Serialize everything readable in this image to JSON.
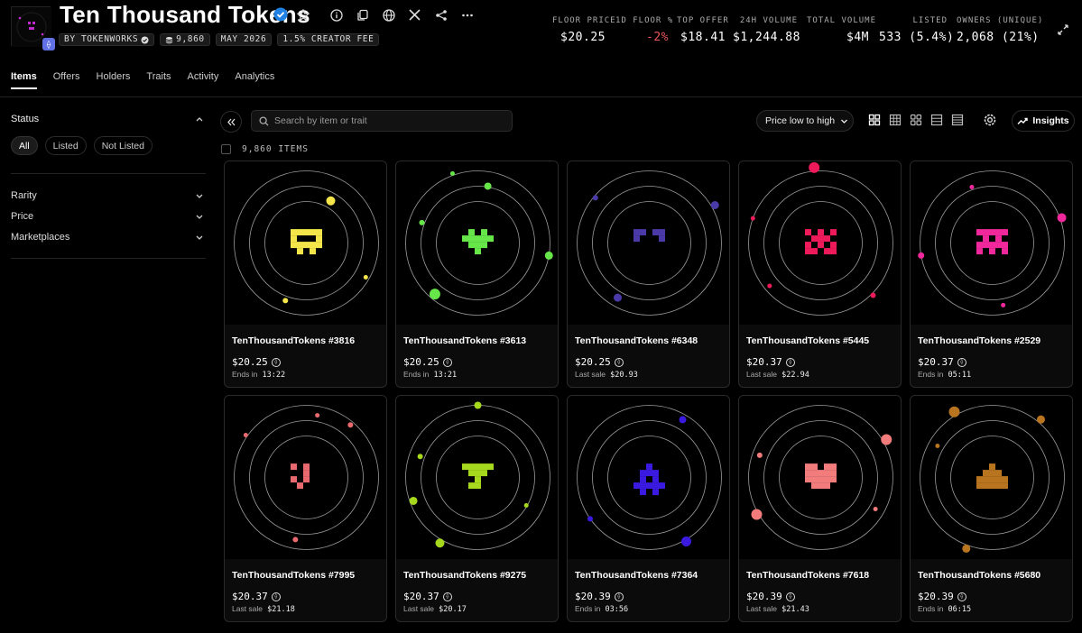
{
  "collection": {
    "title": "Ten Thousand Tokens",
    "by_label": "BY TOKENWORKS",
    "supply": "9,860",
    "date": "MAY 2026",
    "fee": "1.5% CREATOR FEE"
  },
  "stats": [
    {
      "label": "FLOOR PRICE",
      "value": "$20.25"
    },
    {
      "label": "1D FLOOR %",
      "value": "-2%"
    },
    {
      "label": "TOP OFFER",
      "value": "$18.41"
    },
    {
      "label": "24H VOLUME",
      "value": "$1,244.88"
    },
    {
      "label": "TOTAL VOLUME",
      "value": "$4M"
    },
    {
      "label": "LISTED",
      "value": "533 (5.4%)"
    },
    {
      "label": "OWNERS (UNIQUE)",
      "value": "2,068 (21%)"
    }
  ],
  "tabs": [
    "Items",
    "Offers",
    "Holders",
    "Traits",
    "Activity",
    "Analytics"
  ],
  "sidebar": {
    "status_title": "Status",
    "status_pills": [
      "All",
      "Listed",
      "Not Listed"
    ],
    "filters": [
      "Rarity",
      "Price",
      "Marketplaces"
    ]
  },
  "toolbar": {
    "search_placeholder": "Search by item or trait",
    "sort_label": "Price low to high",
    "insights_label": "Insights"
  },
  "items_count": "9,860 ITEMS",
  "cards": [
    {
      "name": "TenThousandTokens #3816",
      "price": "$20.25",
      "sub_prefix": "Ends in",
      "sub_value": "13:22",
      "color": "#f4e64a"
    },
    {
      "name": "TenThousandTokens #3613",
      "price": "$20.25",
      "sub_prefix": "Ends in",
      "sub_value": "13:21",
      "color": "#67e64a"
    },
    {
      "name": "TenThousandTokens #6348",
      "price": "$20.25",
      "sub_prefix": "Last sale",
      "sub_value": "$20.93",
      "color": "#4a3aa8"
    },
    {
      "name": "TenThousandTokens #5445",
      "price": "$20.37",
      "sub_prefix": "Last sale",
      "sub_value": "$22.94",
      "color": "#ee1a5a"
    },
    {
      "name": "TenThousandTokens #2529",
      "price": "$20.37",
      "sub_prefix": "Ends in",
      "sub_value": "05:11",
      "color": "#f0289c"
    },
    {
      "name": "TenThousandTokens #7995",
      "price": "$20.37",
      "sub_prefix": "Last sale",
      "sub_value": "$21.18",
      "color": "#e86a6e"
    },
    {
      "name": "TenThousandTokens #9275",
      "price": "$20.37",
      "sub_prefix": "Last sale",
      "sub_value": "$20.17",
      "color": "#a6d81e"
    },
    {
      "name": "TenThousandTokens #7364",
      "price": "$20.39",
      "sub_prefix": "Ends in",
      "sub_value": "03:56",
      "color": "#3a1ae0"
    },
    {
      "name": "TenThousandTokens #7618",
      "price": "$20.39",
      "sub_prefix": "Last sale",
      "sub_value": "$21.43",
      "color": "#f27c7c"
    },
    {
      "name": "TenThousandTokens #5680",
      "price": "$20.39",
      "sub_prefix": "Ends in",
      "sub_value": "06:15",
      "color": "#b8741e"
    }
  ]
}
